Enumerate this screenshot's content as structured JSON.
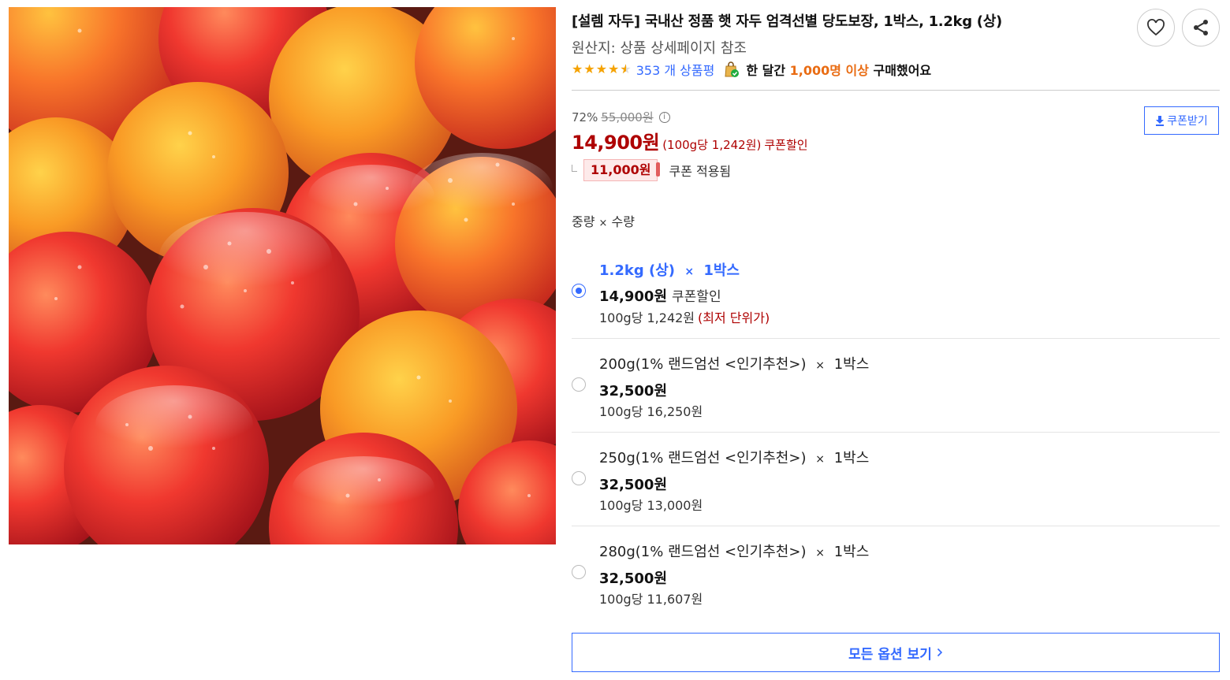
{
  "product": {
    "title": "[설렘 자두] 국내산 정품 햇 자두 엄격선별 당도보장, 1박스, 1.2kg (상)",
    "origin": "원산지: 상품 상세페이지 참조",
    "rating": 4.5,
    "review_count": "353 개 상품평",
    "purchase_prefix": "한 달간",
    "purchase_highlight": "1,000명 이상",
    "purchase_suffix": "구매했어요"
  },
  "actions": {
    "favorite_icon": "heart-icon",
    "share_icon": "share-icon"
  },
  "pricing": {
    "discount_rate": "72%",
    "original_price": "55,000원",
    "coupon_button": "쿠폰받기",
    "sale_price": "14,900원",
    "unit_price": "(100g당 1,242원)",
    "coupon_discount": "쿠폰할인",
    "coupon_amount": "11,000원",
    "coupon_applied": "쿠폰 적용됨"
  },
  "options_header": {
    "weight": "중량",
    "times": "×",
    "quantity": "수량"
  },
  "options": [
    {
      "name": "1.2kg (상)",
      "count": "1박스",
      "price": "14,900원",
      "price_note": "쿠폰할인",
      "unit": "100g당 1,242원",
      "unit_note": "(최저 단위가)",
      "selected": true
    },
    {
      "name": "200g(1% 랜드엄선 <인기추천>)",
      "count": "1박스",
      "price": "32,500원",
      "price_note": "",
      "unit": "100g당 16,250원",
      "unit_note": "",
      "selected": false
    },
    {
      "name": "250g(1% 랜드엄선 <인기추천>)",
      "count": "1박스",
      "price": "32,500원",
      "price_note": "",
      "unit": "100g당 13,000원",
      "unit_note": "",
      "selected": false
    },
    {
      "name": "280g(1% 랜드엄선 <인기추천>)",
      "count": "1박스",
      "price": "32,500원",
      "price_note": "",
      "unit": "100g당 11,607원",
      "unit_note": "",
      "selected": false
    }
  ],
  "view_all": "모든 옵션 보기",
  "colors": {
    "accent_blue": "#346aff",
    "price_red": "#ae0000",
    "highlight_orange": "#e96c13",
    "star": "#f5a200"
  }
}
